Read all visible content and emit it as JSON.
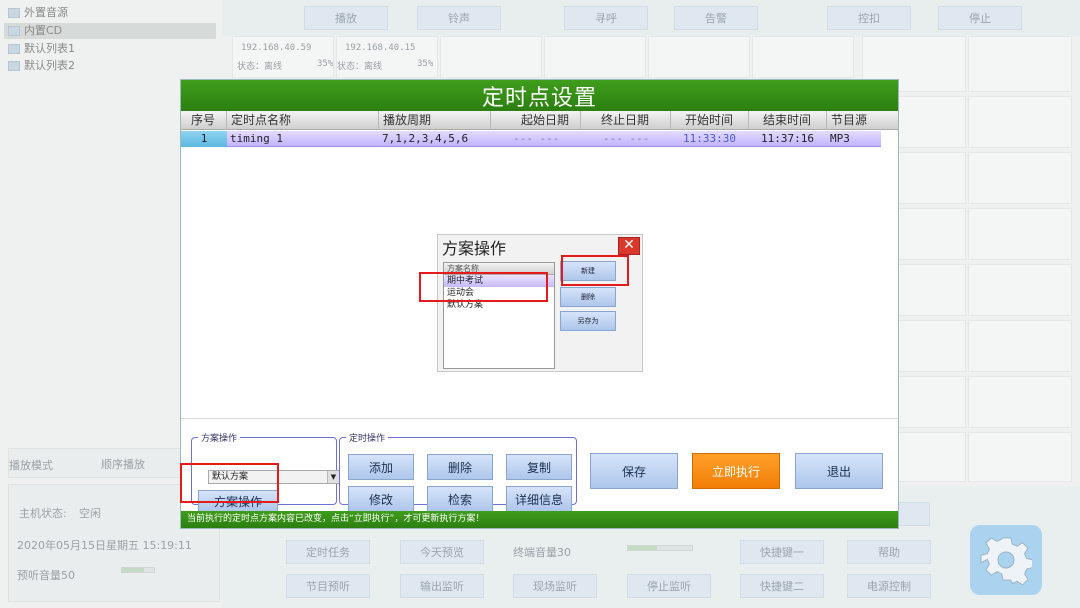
{
  "sources": [
    "外置音源",
    "内置CD",
    "默认列表1",
    "默认列表2"
  ],
  "top_buttons": [
    "播放",
    "铃声",
    "寻呼",
    "告警",
    "控扣",
    "停止"
  ],
  "terminals": [
    {
      "ip": "192.168.40.59",
      "status": "状态：离线",
      "pct": "35%"
    },
    {
      "ip": "192.168.40.15",
      "status": "状态：离线",
      "pct": "35%"
    }
  ],
  "left_bottom": {
    "play_mode_label": "播放模式",
    "play_mode_value": "顺序播放",
    "host_status_label": "主机状态:",
    "host_status_value": "空闲",
    "datetime": "2020年05月15日星期五  15:19:11",
    "preview_volume": "预听音量50"
  },
  "bottom_buttons_row1": [
    "定时任务",
    "今天预览",
    "终端音量30",
    "快捷键一",
    "帮助"
  ],
  "bottom_buttons_row2": [
    "节目预听",
    "输出监听",
    "现场监听",
    "停止监听",
    "快捷键二",
    "电源控制"
  ],
  "dialog": {
    "title": "定时点设置",
    "columns": [
      "序号",
      "定时点名称",
      "播放周期",
      "起始日期",
      "终止日期",
      "开始时间",
      "结束时间",
      "节目源"
    ],
    "rows": [
      [
        "1",
        "timing 1",
        "7,1,2,3,4,5,6",
        "--- ---",
        "--- ---",
        "11:33:30",
        "11:37:16",
        "MP3"
      ]
    ],
    "scheme_group": {
      "legend": "方案操作",
      "select_value": "默认方案",
      "button": "方案操作"
    },
    "timing_group": {
      "legend": "定时操作",
      "buttons": [
        "添加",
        "删除",
        "复制",
        "修改",
        "检索",
        "详细信息"
      ]
    },
    "actions": {
      "save": "保存",
      "run": "立即执行",
      "exit": "退出"
    },
    "status": "当前执行的定时点方案内容已改变，点击“立即执行”，才可更新执行方案！"
  },
  "sub_dialog": {
    "title": "方案操作",
    "close": "✕",
    "list_header": "方案名称",
    "items": [
      "期中考试",
      "运动会",
      "默认方案"
    ],
    "buttons": [
      "新建",
      "删除",
      "另存为"
    ]
  },
  "colors": {
    "title_green": "#3f9d1c",
    "run_orange": "#f27e06",
    "highlight_red": "#e51b1b"
  }
}
